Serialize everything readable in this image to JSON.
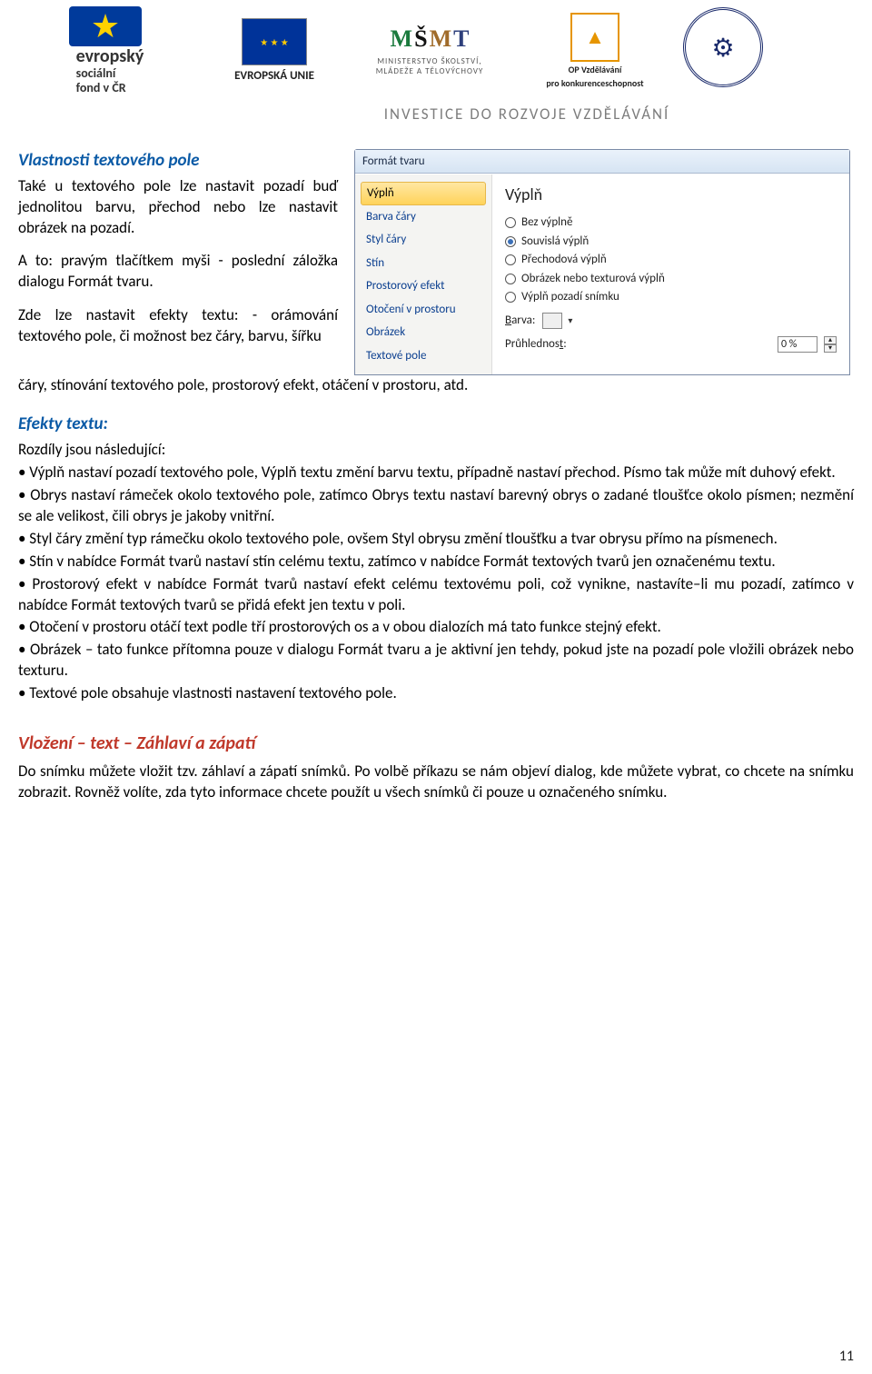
{
  "header": {
    "esf_text_top": "evropský",
    "esf_text_mid": "sociální",
    "esf_text_bot": "fond v ČR",
    "eu_label": "EVROPSKÁ UNIE",
    "msmt_line1": "MINISTERSTVO ŠKOLSTVÍ,",
    "msmt_line2": "MLÁDEŽE A TĚLOVÝCHOVY",
    "opvk_line1": "OP Vzdělávání",
    "opvk_line2": "pro konkurenceschopnost",
    "investice": "INVESTICE DO ROZVOJE VZDĚLÁVÁNÍ"
  },
  "section1": {
    "title": "Vlastnosti textového pole",
    "p1": "Také u textového pole lze nastavit pozadí buď jednolitou barvu, přechod nebo lze nastavit obrázek na pozadí.",
    "p2": "A to: pravým tlačítkem myši - poslední záložka dialogu Formát tvaru.",
    "p3": "Zde lze nastavit efekty textu: - orámování textového pole, či možnost bez čáry, barvu, šířku čáry, stínování textového pole, prostorový efekt, otáčení v prostoru, atd."
  },
  "dialog": {
    "title": "Formát tvaru",
    "cats": [
      "Výplň",
      "Barva čáry",
      "Styl čáry",
      "Stín",
      "Prostorový efekt",
      "Otočení v prostoru",
      "Obrázek",
      "Textové pole"
    ],
    "panel_title": "Výplň",
    "radios": [
      "Bez výplně",
      "Souvislá výplň",
      "Přechodová výplň",
      "Obrázek nebo texturová výplň",
      "Výplň pozadí snímku"
    ],
    "color_label": "Barva:",
    "opacity_label": "Průhlednost:",
    "opacity_value": "0 %"
  },
  "section2": {
    "title": "Efekty textu:",
    "lead": "Rozdíly jsou následující:",
    "b1": "• Výplň nastaví pozadí textového pole, Výplň textu změní barvu textu, případně nastaví přechod. Písmo tak může mít duhový efekt.",
    "b2": "• Obrys nastaví rámeček okolo textového pole, zatímco Obrys textu nastaví barevný obrys o zadané tloušťce okolo písmen; nezmění se ale velikost, čili obrys je jakoby vnitřní.",
    "b3": "• Styl čáry změní typ rámečku okolo textového pole, ovšem Styl obrysu změní tloušťku a tvar obrysu přímo na písmenech.",
    "b4": "• Stín v nabídce Formát tvarů nastaví stín celému textu, zatímco v nabídce Formát textových tvarů jen označenému textu.",
    "b5": "• Prostorový efekt v nabídce Formát tvarů nastaví efekt celému textovému poli, což vynikne, nastavíte–li mu pozadí, zatímco v nabídce Formát textových tvarů se přidá efekt jen textu v poli.",
    "b6": "• Otočení v prostoru otáčí text podle tří prostorových os a v obou dialozích má tato funkce stejný efekt.",
    "b7": "• Obrázek – tato funkce přítomna pouze v dialogu Formát tvaru a je aktivní jen tehdy, pokud jste na pozadí pole vložili obrázek nebo texturu.",
    "b8": "• Textové pole obsahuje vlastnosti nastavení textového pole."
  },
  "section3": {
    "title": "Vložení – text – Záhlaví a zápatí",
    "p1": "Do snímku můžete vložit tzv. záhlaví a zápatí snímků. Po volbě příkazu se nám objeví dialog, kde můžete vybrat, co chcete na snímku zobrazit. Rovněž volíte, zda tyto informace chcete použít u všech snímků či pouze u označeného snímku."
  },
  "page_number": "11"
}
